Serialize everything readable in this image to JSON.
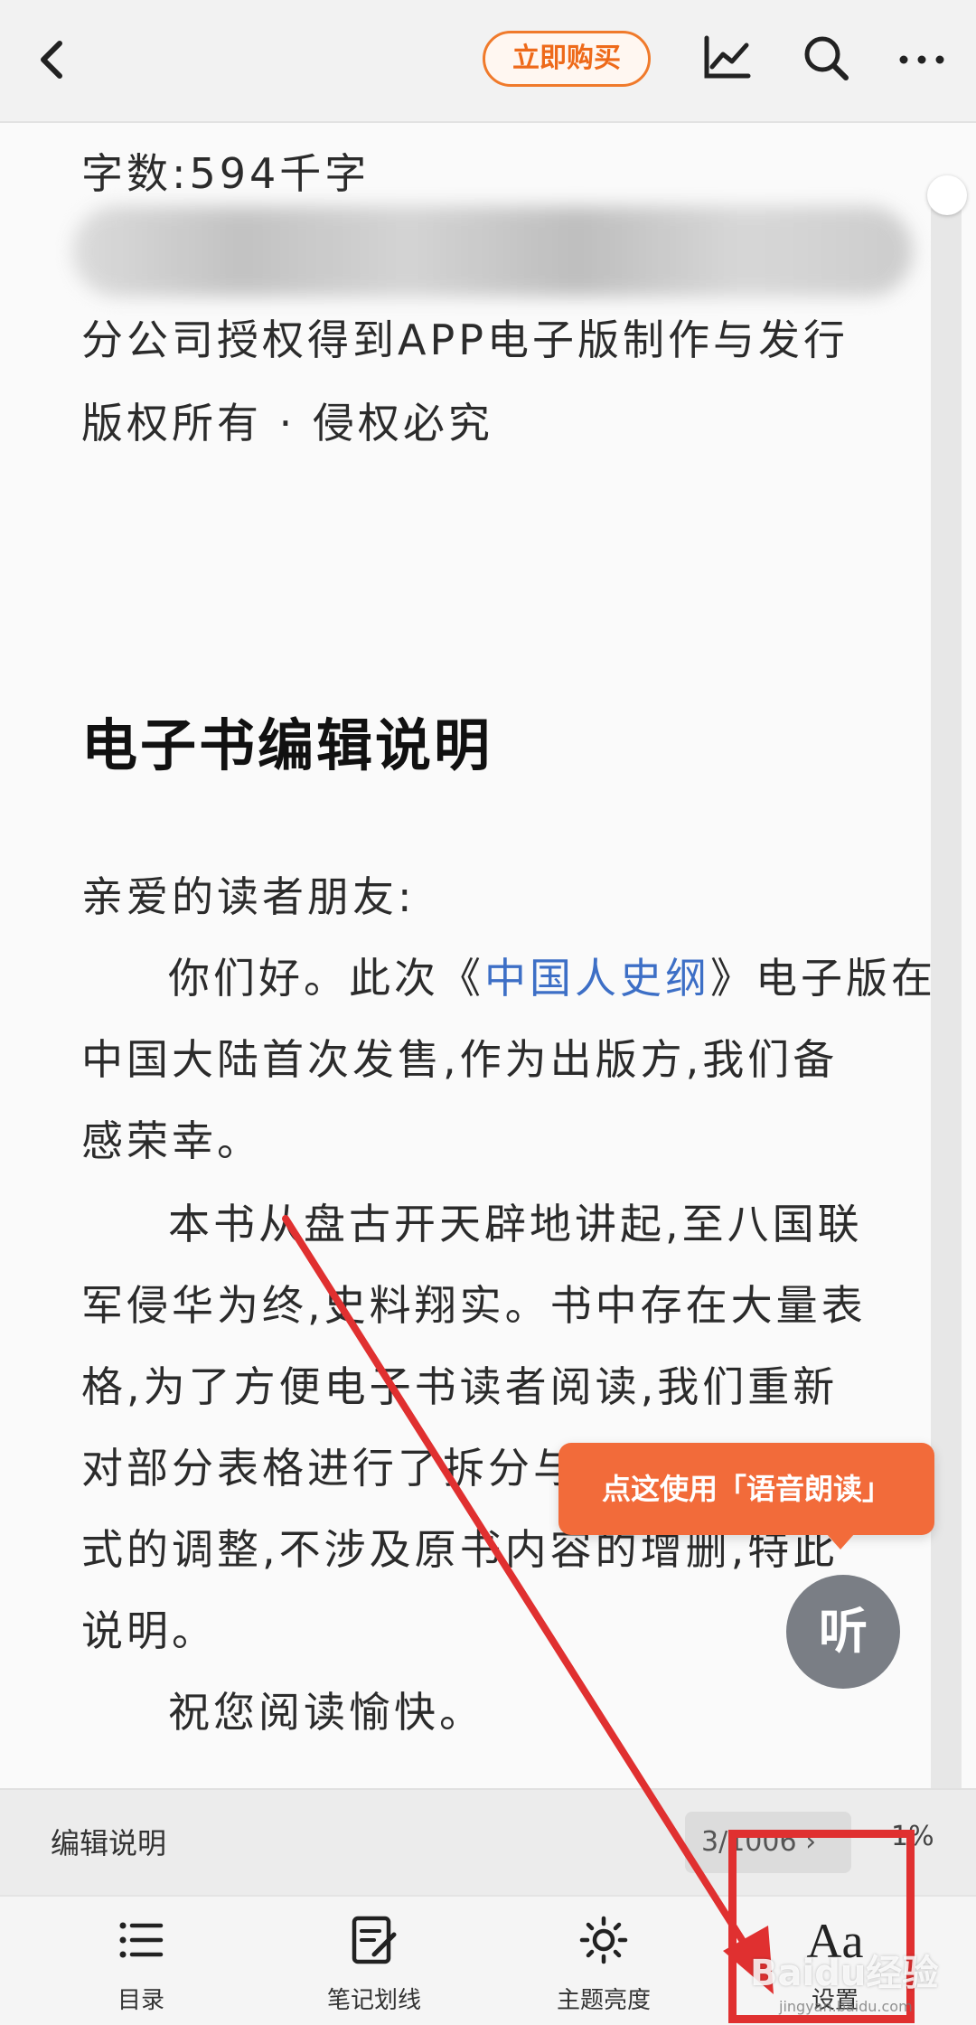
{
  "top_bar": {
    "back_icon": "chevron-left-icon",
    "buy_label": "立即购买",
    "trend_icon": "trend-chart-icon",
    "search_icon": "search-icon",
    "more_icon": "more-horizontal-icon",
    "accent_color": "#f07a2b"
  },
  "content": {
    "word_count": "字数:594千字",
    "copyright_line1": "分公司授权得到APP电子版制作与发行",
    "copyright_line2": "版权所有 · 侵权必究",
    "section_title": "电子书编辑说明",
    "greeting": "亲爱的读者朋友:",
    "para1": {
      "line1_pre": "你们好。此次《",
      "book_title": "中国人史纲",
      "line1_post": "》电子版在",
      "line2": "中国大陆首次发售,作为出版方,我们备",
      "line3": "感荣幸。"
    },
    "para2": {
      "line1": "本书从盘古开天辟地讲起,至八国联",
      "line2": "军侵华为终,史料翔实。书中存在大量表",
      "line3": "格,为了方便电子书读者阅读,我们重新",
      "line4": "对部分表格进行了拆分与",
      "line5": "式的调整,不涉及原书内容的增删,特此",
      "line6": "说明。"
    },
    "closing": "祝您阅读愉快。",
    "link_color": "#3d6fc6"
  },
  "listen": {
    "tooltip": "点这使用「语音朗读」",
    "button_label": "听",
    "tooltip_color": "#f26b3a"
  },
  "chapter_bar": {
    "chapter_name": "编辑说明",
    "page_indicator": "3/1006 ›",
    "percent": "1%"
  },
  "bottom_nav": [
    {
      "label": "目录",
      "icon": "list-icon"
    },
    {
      "label": "笔记划线",
      "icon": "note-edit-icon"
    },
    {
      "label": "主题亮度",
      "icon": "brightness-icon"
    },
    {
      "label": "设置",
      "icon": "font-settings-icon",
      "glyph": "Aa"
    }
  ],
  "annotation": {
    "highlight_color": "#e03030",
    "watermark": "Baidu经验",
    "watermark_url": "jingyan.baidu.com"
  }
}
